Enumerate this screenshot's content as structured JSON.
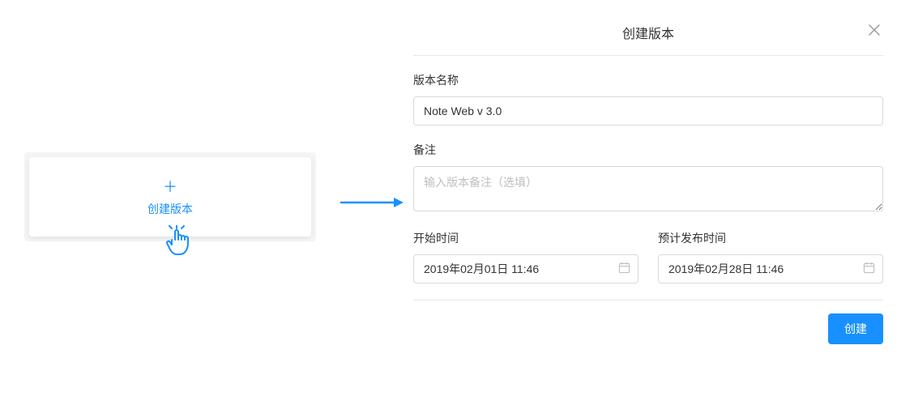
{
  "left": {
    "create_label": "创建版本"
  },
  "modal": {
    "title": "创建版本",
    "fields": {
      "name_label": "版本名称",
      "name_value": "Note Web v 3.0",
      "remark_label": "备注",
      "remark_placeholder": "输入版本备注（选填）",
      "start_label": "开始时间",
      "start_value": "2019年02月01日 11:46",
      "end_label": "预计发布时间",
      "end_value": "2019年02月28日 11:46"
    },
    "submit_label": "创建"
  }
}
